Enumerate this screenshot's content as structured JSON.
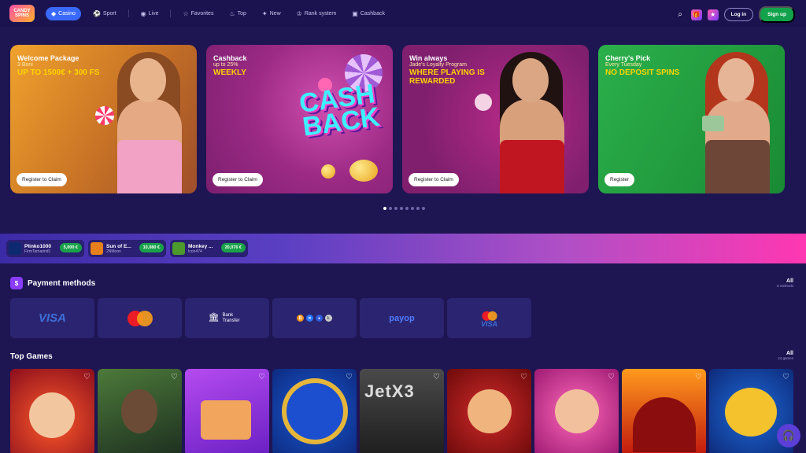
{
  "header": {
    "logo_text": "CANDY SPINS",
    "nav": [
      {
        "label": "Casino",
        "icon": "diamond-icon",
        "active": true
      },
      {
        "label": "Sport",
        "icon": "ball-icon"
      },
      {
        "label": "Live",
        "icon": "live-icon"
      },
      {
        "label": "Favorites",
        "icon": "star-icon"
      },
      {
        "label": "Top",
        "icon": "flame-icon"
      },
      {
        "label": "New",
        "icon": "badge-icon"
      },
      {
        "label": "Rank system",
        "icon": "rank-icon"
      },
      {
        "label": "Cashback",
        "icon": "cashback-icon"
      }
    ],
    "login_label": "Log in",
    "signup_label": "Sign up"
  },
  "banners": [
    {
      "title": "Welcome Package",
      "subtitle": "3 Boni",
      "headline": "UP TO 1500€ + 300 FS",
      "button": "Register to Claim"
    },
    {
      "title": "Cashback",
      "subtitle": "up to 25%",
      "headline": "WEEKLY",
      "button": "Register to Claim",
      "art_text": "CASH BACK"
    },
    {
      "title": "Win always",
      "subtitle": "Jade's Loyalty Program",
      "headline": "WHERE PLAYING IS REWARDED",
      "button": "Register to Claim"
    },
    {
      "title": "Cherry's Pick",
      "subtitle": "Every Tuesday",
      "headline": "NO DEPOSIT SPINS",
      "button": "Register"
    }
  ],
  "carousel": {
    "count": 8,
    "active_index": 0
  },
  "winners": [
    {
      "game": "Plinko1000",
      "user": "FirmTamarind1",
      "amount": "5,000 €"
    },
    {
      "game": "Sun of E...",
      "user": "2NMoon",
      "amount": "10,080 €"
    },
    {
      "game": "Monkey ...",
      "user": "Icon474",
      "amount": "20,076 €"
    }
  ],
  "payment": {
    "title": "Payment methods",
    "all_label": "All",
    "count_label": "6 methods",
    "methods": [
      {
        "name": "visa",
        "label": "VISA"
      },
      {
        "name": "mastercard",
        "label": ""
      },
      {
        "name": "bank-transfer",
        "label": "Bank Transfer"
      },
      {
        "name": "crypto",
        "label": ""
      },
      {
        "name": "payop",
        "label": "payop"
      },
      {
        "name": "mastercard-visa",
        "label": "VISA"
      }
    ]
  },
  "top_games": {
    "title": "Top Games",
    "all_label": "All",
    "count_label": "24 games",
    "games": [
      {
        "name": "joker-game"
      },
      {
        "name": "rapper-game"
      },
      {
        "name": "pyramid-game"
      },
      {
        "name": "lightning-game"
      },
      {
        "name": "JetX3"
      },
      {
        "name": "mexican-game"
      },
      {
        "name": "jester-game"
      },
      {
        "name": "volcano-game"
      },
      {
        "name": "clover-game"
      }
    ]
  },
  "colors": {
    "accent": "#3a69ff",
    "signup": "#12a24c",
    "bg": "#1e1553"
  }
}
